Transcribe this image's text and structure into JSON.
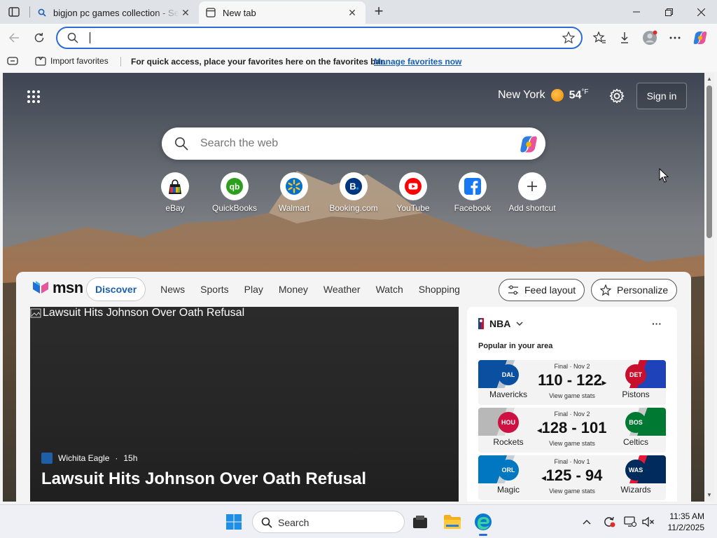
{
  "browser": {
    "tabs": [
      {
        "title": "bigjon pc games collection - Search",
        "active": false
      },
      {
        "title": "New tab",
        "active": true
      }
    ],
    "address_bar": {
      "value": "",
      "placeholder": ""
    },
    "favorites_bar": {
      "import_label": "Import favorites",
      "message": "For quick access, place your favorites here on the favorites bar.",
      "manage_link": "Manage favorites now"
    }
  },
  "newtab": {
    "weather": {
      "city": "New York",
      "temp": "54",
      "unit": "°F"
    },
    "signin_label": "Sign in",
    "search_placeholder": "Search the web",
    "shortcuts": [
      {
        "label": "eBay",
        "icon": "ebay-icon"
      },
      {
        "label": "QuickBooks",
        "icon": "quickbooks-icon"
      },
      {
        "label": "Walmart",
        "icon": "walmart-icon"
      },
      {
        "label": "Booking.com",
        "icon": "booking-icon"
      },
      {
        "label": "YouTube",
        "icon": "youtube-icon"
      },
      {
        "label": "Facebook",
        "icon": "facebook-icon"
      },
      {
        "label": "Add shortcut",
        "icon": "plus-icon"
      }
    ]
  },
  "feed": {
    "logo_text": "msn",
    "nav": [
      "Discover",
      "News",
      "Sports",
      "Play",
      "Money",
      "Weather",
      "Watch",
      "Shopping"
    ],
    "feed_layout_label": "Feed layout",
    "personalize_label": "Personalize",
    "hero": {
      "image_alt": "Lawsuit Hits Johnson Over Oath Refusal",
      "source": "Wichita Eagle",
      "age": "15h",
      "title": "Lawsuit Hits Johnson Over Oath Refusal"
    },
    "nba": {
      "title": "NBA",
      "subtitle": "Popular in your area",
      "games": [
        {
          "status": "Final · Nov 2",
          "score": "110 - 122",
          "winner_arrow": "▸",
          "home": "Mavericks",
          "away": "Pistons",
          "stats": "View game stats",
          "home_color": "#0a4fa0",
          "away_color": "#1d42ba"
        },
        {
          "status": "Final · Nov 2",
          "score": "128 - 101",
          "winner_arrow": "◂",
          "home": "Rockets",
          "away": "Celtics",
          "stats": "View game stats",
          "home_color": "#ce1141",
          "away_color": "#007a33"
        },
        {
          "status": "Final · Nov 1",
          "score": "125 - 94",
          "winner_arrow": "◂",
          "home": "Magic",
          "away": "Wizards",
          "stats": "View game stats",
          "home_color": "#0077c0",
          "away_color": "#002b5c"
        }
      ]
    }
  },
  "taskbar": {
    "search_label": "Search",
    "time": "11:35 AM",
    "date": "11/2/2025"
  }
}
